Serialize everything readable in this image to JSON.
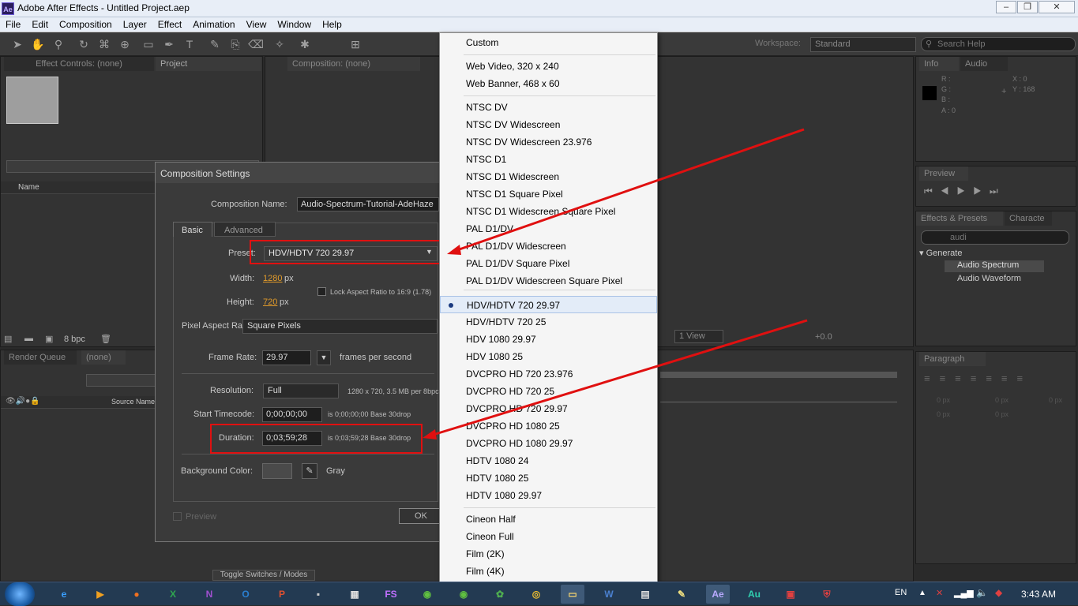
{
  "window": {
    "title": "Adobe After Effects - Untitled Project.aep",
    "app_icon": "Ae",
    "minimize": "▭",
    "restore": "❐",
    "close": "✕"
  },
  "menubar": [
    "File",
    "Edit",
    "Composition",
    "Layer",
    "Effect",
    "Animation",
    "View",
    "Window",
    "Help"
  ],
  "workspace": {
    "label": "Workspace:",
    "value": "Standard",
    "search_placeholder": "Search Help"
  },
  "left_panel": {
    "tab_effect_controls": "Effect Controls: (none)",
    "tab_project": "Project",
    "col_name": "Name",
    "bpc": "8 bpc"
  },
  "comp_panel": {
    "tab": "Composition: (none)",
    "view_select": "1 View",
    "exposure": "+0.0"
  },
  "timeline": {
    "tab_render": "Render Queue",
    "tab_none": "(none)",
    "col_source": "Source Name",
    "toggle": "Toggle Switches / Modes"
  },
  "info_panel": {
    "tab_info": "Info",
    "tab_audio": "Audio",
    "r": "R :",
    "g": "G :",
    "b": "B :",
    "a": "A : 0",
    "x": "X : 0",
    "y": "Y : 168"
  },
  "preview_panel": {
    "tab": "Preview"
  },
  "effects_panel": {
    "tab": "Effects & Presets",
    "tab_char": "Characte",
    "search": "audi",
    "group": "Generate",
    "items": [
      "Audio Spectrum",
      "Audio Waveform"
    ]
  },
  "paragraph_panel": {
    "tab": "Paragraph",
    "v1": "0 px",
    "v2": "0 px",
    "v3": "0 px",
    "v4": "0 px",
    "v5": "0 px"
  },
  "dialog": {
    "title": "Composition Settings",
    "name_label": "Composition Name:",
    "name_value": "Audio-Spectrum-Tutorial-AdeHaze",
    "tab_basic": "Basic",
    "tab_advanced": "Advanced",
    "preset_label": "Preset:",
    "preset_value": "HDV/HDTV 720 29.97",
    "width_label": "Width:",
    "width_value": "1280",
    "px1": "px",
    "height_label": "Height:",
    "height_value": "720",
    "px2": "px",
    "lock_label": "Lock Aspect Ratio to 16:9 (1.78)",
    "par_label": "Pixel Aspect Ratio:",
    "par_value": "Square Pixels",
    "fr_label": "Frame Rate:",
    "fr_value": "29.97",
    "fr_unit": "frames per second",
    "res_label": "Resolution:",
    "res_value": "Full",
    "res_info": "1280 x 720, 3.5 MB per 8bpc",
    "start_label": "Start Timecode:",
    "start_value": "0;00;00;00",
    "start_info": "is 0;00;00;00  Base 30drop",
    "dur_label": "Duration:",
    "dur_value": "0;03;59;28",
    "dur_info": "is 0;03;59;28  Base 30drop",
    "bg_label": "Background Color:",
    "bg_name": "Gray",
    "preview_label": "Preview",
    "ok": "OK"
  },
  "preset_menu": {
    "groups": [
      [
        "Custom"
      ],
      [
        "Web Video, 320 x 240",
        "Web Banner, 468 x 60"
      ],
      [
        "NTSC DV",
        "NTSC DV Widescreen",
        "NTSC DV Widescreen 23.976",
        "NTSC D1",
        "NTSC D1 Widescreen",
        "NTSC D1 Square Pixel",
        "NTSC D1 Widescreen Square Pixel",
        "PAL D1/DV",
        "PAL D1/DV Widescreen",
        "PAL D1/DV Square Pixel",
        "PAL D1/DV Widescreen Square Pixel"
      ],
      [
        "HDV/HDTV 720 29.97",
        "HDV/HDTV 720 25",
        "HDV 1080 29.97",
        "HDV 1080 25",
        "DVCPRO HD 720 23.976",
        "DVCPRO HD 720 25",
        "DVCPRO HD 720 29.97",
        "DVCPRO HD 1080 25",
        "DVCPRO HD 1080 29.97",
        "HDTV 1080 24",
        "HDTV 1080 25",
        "HDTV 1080 29.97"
      ],
      [
        "Cineon Half",
        "Cineon Full",
        "Film (2K)",
        "Film (4K)"
      ]
    ],
    "selected": "HDV/HDTV 720 29.97"
  },
  "colors": {
    "annotation": "#e01010",
    "menu_highlight": "#e3ecf8"
  },
  "taskbar": {
    "lang": "EN",
    "time": "3:43 AM",
    "apps": [
      "ie-icon",
      "media-icon",
      "firefox-icon",
      "excel-icon",
      "onenote-icon",
      "outlook-icon",
      "powerpoint-icon",
      "cmd-icon",
      "clapper-icon",
      "fs-icon",
      "android-icon",
      "android2-icon",
      "puzzle-icon",
      "chrome-icon",
      "explorer-icon",
      "word-icon",
      "doc-icon",
      "notepad-icon",
      "aftereffects-icon",
      "audition-icon",
      "presentation-icon",
      "shield-icon"
    ],
    "app_labels": {
      "excel": "X",
      "onenote": "N",
      "outlook": "O",
      "powerpoint": "P",
      "fs": "FS",
      "aftereffects": "Ae",
      "audition": "Au",
      "word": "W"
    }
  }
}
